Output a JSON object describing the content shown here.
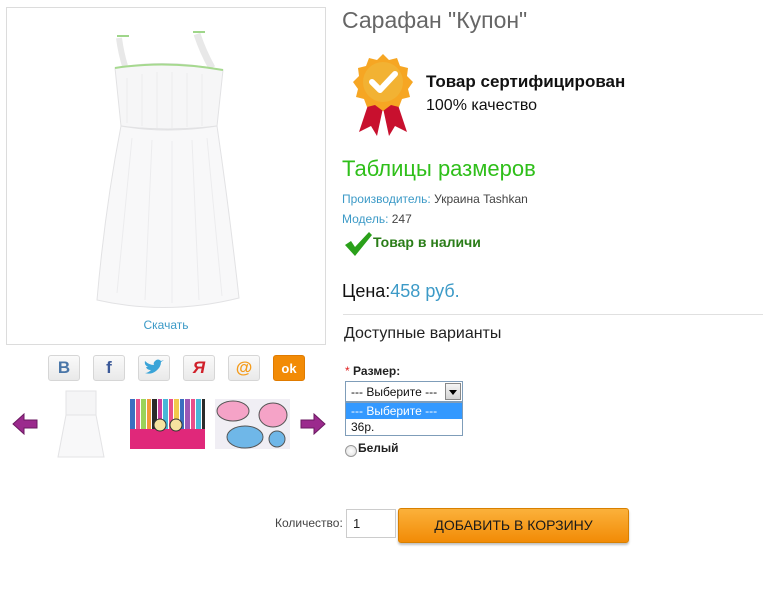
{
  "product": {
    "title": "Сарафан \"Купон\"",
    "download_label": "Скачать",
    "certificate": {
      "title": "Товар сертифицирован",
      "subtitle": "100% качество",
      "icon": "certificate-badge-icon"
    },
    "size_tables_link": "Таблицы размеров",
    "manufacturer_label": "Производитель:",
    "manufacturer_value": "Украина Tashkan",
    "model_label": "Модель:",
    "model_value": "247",
    "stock_status": "Товар в наличи",
    "price_label": "Цена:",
    "price_value": "458 руб."
  },
  "social": [
    {
      "name": "vk",
      "glyph": "B",
      "color": "#4a76a8"
    },
    {
      "name": "facebook",
      "glyph": "f",
      "color": "#3b5998"
    },
    {
      "name": "twitter",
      "glyph": "t",
      "color": "#3aa4d8"
    },
    {
      "name": "my-world",
      "glyph": "Я",
      "color": "#d0202a"
    },
    {
      "name": "mail",
      "glyph": "@",
      "color": "#f49b1a"
    },
    {
      "name": "odnoklassniki",
      "glyph": "ok",
      "color": "#f28b06"
    }
  ],
  "options": {
    "heading": "Доступные варианты",
    "size_required_mark": "*",
    "size_label": "Размер:",
    "size_selected": "--- Выберите ---",
    "size_options": [
      "--- Выберите ---",
      "36р."
    ],
    "color_option": "Белый"
  },
  "cart": {
    "quantity_label": "Количество:",
    "quantity_value": "1",
    "add_button": "ДОБАВИТЬ В КОРЗИНУ"
  },
  "colors": {
    "accent_blue": "#3c9ac7",
    "green_link": "#2fbf1a",
    "cart_orange": "#f28b06"
  }
}
